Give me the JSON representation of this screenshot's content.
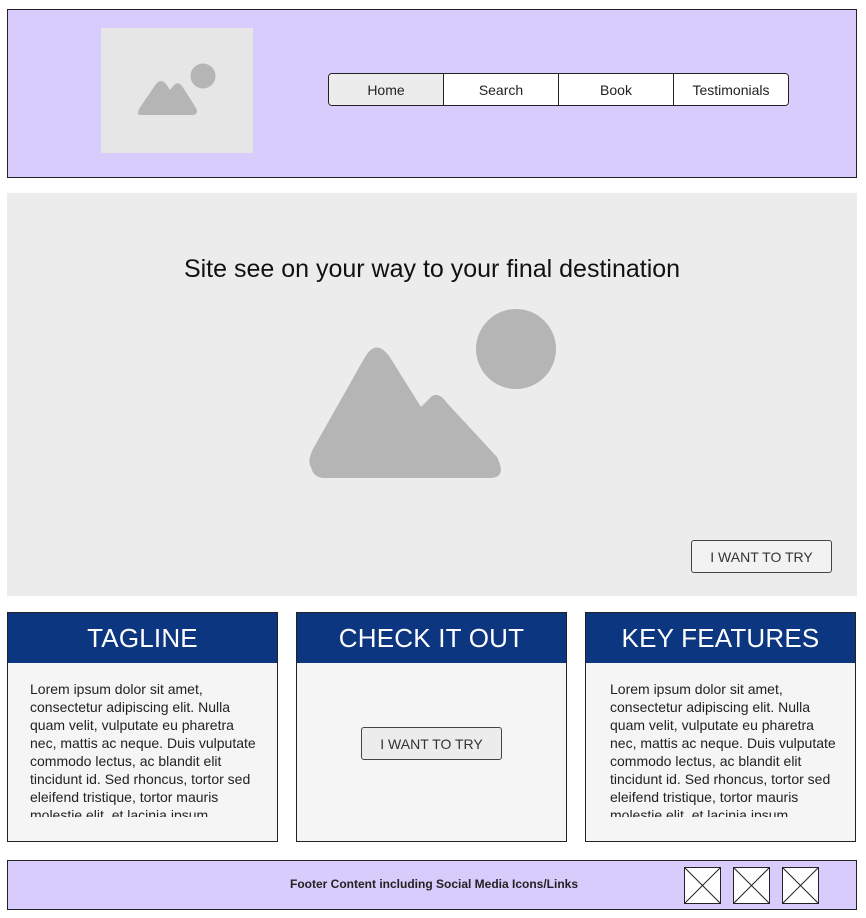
{
  "header": {
    "logo": {
      "icon": "image-placeholder-icon"
    },
    "nav": [
      {
        "label": "Home",
        "active": true
      },
      {
        "label": "Search",
        "active": false
      },
      {
        "label": "Book",
        "active": false
      },
      {
        "label": "Testimonials",
        "active": false
      }
    ]
  },
  "hero": {
    "title": "Site see on your way to your final destination",
    "image_icon": "image-placeholder-icon",
    "cta_label": "I WANT TO TRY"
  },
  "cards": [
    {
      "heading": "TAGLINE",
      "text": "Lorem ipsum dolor sit amet, consectetur adipiscing elit. Nulla quam velit, vulputate eu pharetra nec, mattis ac neque. Duis vulputate commodo lectus, ac blandit elit tincidunt id. Sed rhoncus, tortor sed eleifend tristique, tortor mauris molestie elit, et lacinia ipsum"
    },
    {
      "heading": "CHECK IT OUT",
      "cta_label": "I WANT TO TRY"
    },
    {
      "heading": "KEY FEATURES",
      "text": "Lorem ipsum dolor sit amet, consectetur adipiscing elit. Nulla quam velit, vulputate eu pharetra nec, mattis ac neque. Duis vulputate commodo lectus, ac blandit elit tincidunt id. Sed rhoncus, tortor sed eleifend tristique, tortor mauris molestie elit, et lacinia ipsum"
    }
  ],
  "footer": {
    "text": "Footer Content including Social Media Icons/Links",
    "social_icons": [
      "social-link-placeholder-icon",
      "social-link-placeholder-icon",
      "social-link-placeholder-icon"
    ]
  },
  "colors": {
    "header_bg": "#d8ccfc",
    "card_heading_bg": "#0d3680",
    "placeholder_gray": "#b5b5b5"
  }
}
